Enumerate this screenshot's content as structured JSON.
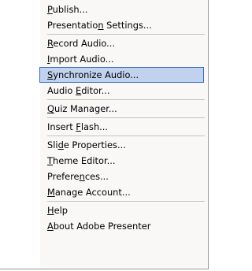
{
  "menu": {
    "items": [
      {
        "pre": "",
        "mn": "P",
        "post": "ublish...",
        "highlighted": false
      },
      {
        "pre": "Presentatio",
        "mn": "n",
        "post": " Settings...",
        "highlighted": false
      },
      {
        "pre": "",
        "mn": "R",
        "post": "ecord Audio...",
        "highlighted": false
      },
      {
        "pre": "",
        "mn": "I",
        "post": "mport Audio...",
        "highlighted": false
      },
      {
        "pre": "",
        "mn": "S",
        "post": "ynchronize Audio...",
        "highlighted": true
      },
      {
        "pre": "Audio ",
        "mn": "E",
        "post": "ditor...",
        "highlighted": false
      },
      {
        "pre": "",
        "mn": "Q",
        "post": "uiz Manager...",
        "highlighted": false
      },
      {
        "pre": "Insert ",
        "mn": "F",
        "post": "lash...",
        "highlighted": false
      },
      {
        "pre": "Sli",
        "mn": "d",
        "post": "e Properties...",
        "highlighted": false
      },
      {
        "pre": "",
        "mn": "T",
        "post": "heme Editor...",
        "highlighted": false
      },
      {
        "pre": "Prefere",
        "mn": "n",
        "post": "ces...",
        "highlighted": false
      },
      {
        "pre": "",
        "mn": "M",
        "post": "anage Account...",
        "highlighted": false
      },
      {
        "pre": "",
        "mn": "H",
        "post": "elp",
        "highlighted": false
      },
      {
        "pre": "",
        "mn": "A",
        "post": "bout Adobe Presenter",
        "highlighted": false
      }
    ]
  }
}
